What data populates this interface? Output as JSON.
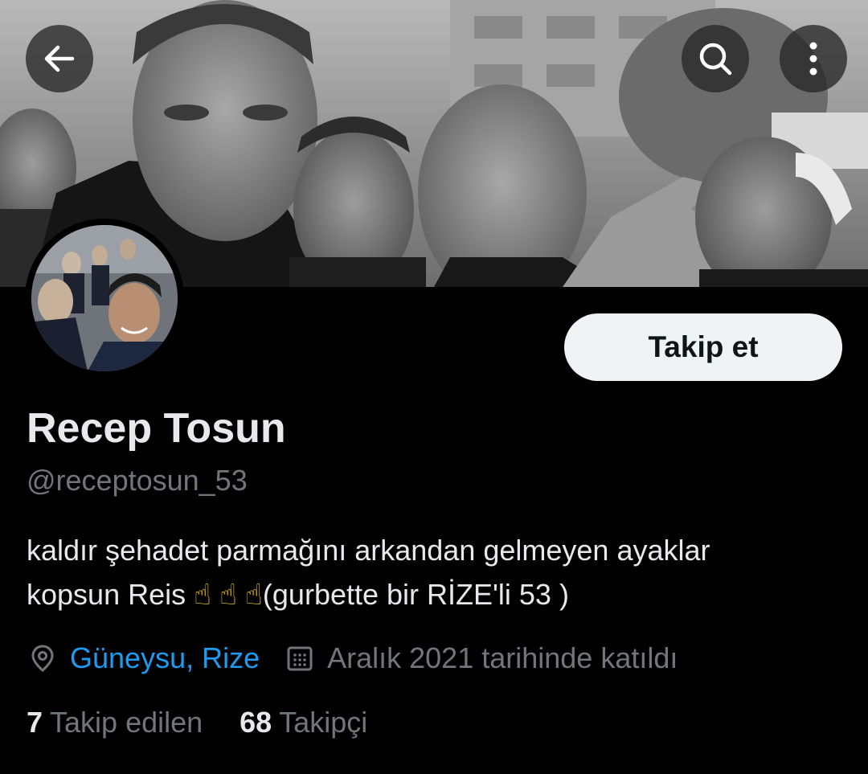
{
  "header": {
    "back_icon": "arrow-left-icon",
    "search_icon": "search-icon",
    "more_icon": "more-vertical-icon"
  },
  "profile": {
    "display_name": "Recep Tosun",
    "handle": "@receptosun_53",
    "follow_label": "Takip et",
    "bio_line1": "kaldır şehadet parmağını arkandan gelmeyen ayaklar",
    "bio_line2_text": "kopsun Reis",
    "bio_emoji": "☝",
    "bio_line2_tail": "(gurbette bir RİZE'li 53 )",
    "location": "Güneysu, Rize",
    "location_icon": "location-pin-icon",
    "joined": "Aralık 2021 tarihinde katıldı",
    "joined_icon": "calendar-icon"
  },
  "stats": {
    "following_count": "7",
    "following_label": "Takip edilen",
    "followers_count": "68",
    "followers_label": "Takipçi"
  },
  "colors": {
    "background": "#000000",
    "link": "#1d9bf0",
    "secondary_text": "#71767b",
    "primary_text": "#e7e9ea",
    "button_bg": "#eff3f4"
  }
}
